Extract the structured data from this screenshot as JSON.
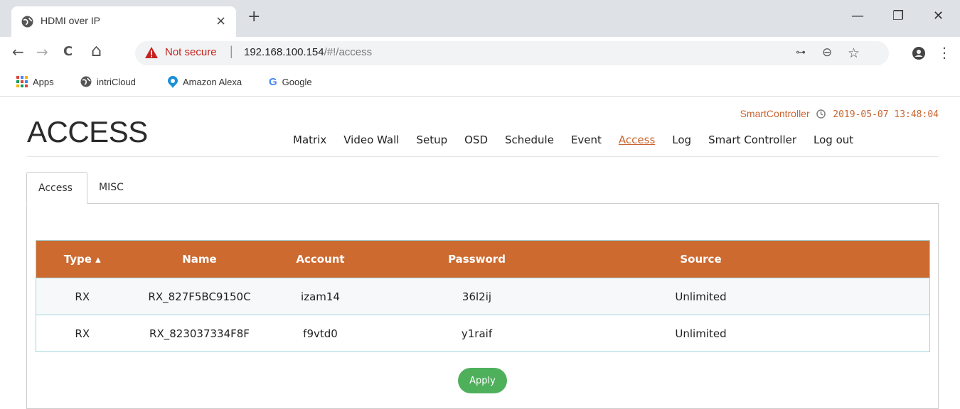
{
  "browser": {
    "tab_title": "HDMI over IP",
    "tab_close": "×",
    "new_tab": "+",
    "window_controls": {
      "minimize": "—",
      "restore": "❐",
      "close": "✕"
    },
    "nav": {
      "back": "←",
      "forward": "→",
      "reload": "C",
      "home": "⌂"
    },
    "address": {
      "security_label": "Not secure",
      "separator": "|",
      "host": "192.168.100.154",
      "path": "/#!/access"
    },
    "toolbar_icons": {
      "key": "🔑",
      "zoom": "🔍",
      "star": "☆",
      "account": "●",
      "menu": "⋮"
    },
    "bookmarks": [
      {
        "icon": "apps-grid-icon",
        "label": "Apps"
      },
      {
        "icon": "globe-icon",
        "label": "intriCloud"
      },
      {
        "icon": "alexa-icon",
        "label": "Amazon Alexa"
      },
      {
        "icon": "google-icon",
        "label": "Google"
      }
    ]
  },
  "header": {
    "controller_label": "SmartController",
    "datetime": "2019-05-07 13:48:04",
    "title": "ACCESS",
    "nav": [
      "Matrix",
      "Video Wall",
      "Setup",
      "OSD",
      "Schedule",
      "Event",
      "Access",
      "Log",
      "Smart Controller",
      "Log out"
    ],
    "active_nav": "Access"
  },
  "subtabs": {
    "active": "Access",
    "other": "MISC"
  },
  "table": {
    "columns": {
      "type": "Type ▴",
      "name": "Name",
      "account": "Account",
      "password": "Password",
      "source": "Source"
    },
    "rows": [
      {
        "type": "RX",
        "name": "RX_827F5BC9150C",
        "account": "izam14",
        "password": "36l2ij",
        "source": "Unlimited"
      },
      {
        "type": "RX",
        "name": "RX_823037334F8F",
        "account": "f9vtd0",
        "password": "y1raif",
        "source": "Unlimited"
      }
    ]
  },
  "apply_label": "Apply",
  "colors": {
    "accent": "#cd6a30",
    "apply": "#4fb05c",
    "status": "#c9652f"
  }
}
